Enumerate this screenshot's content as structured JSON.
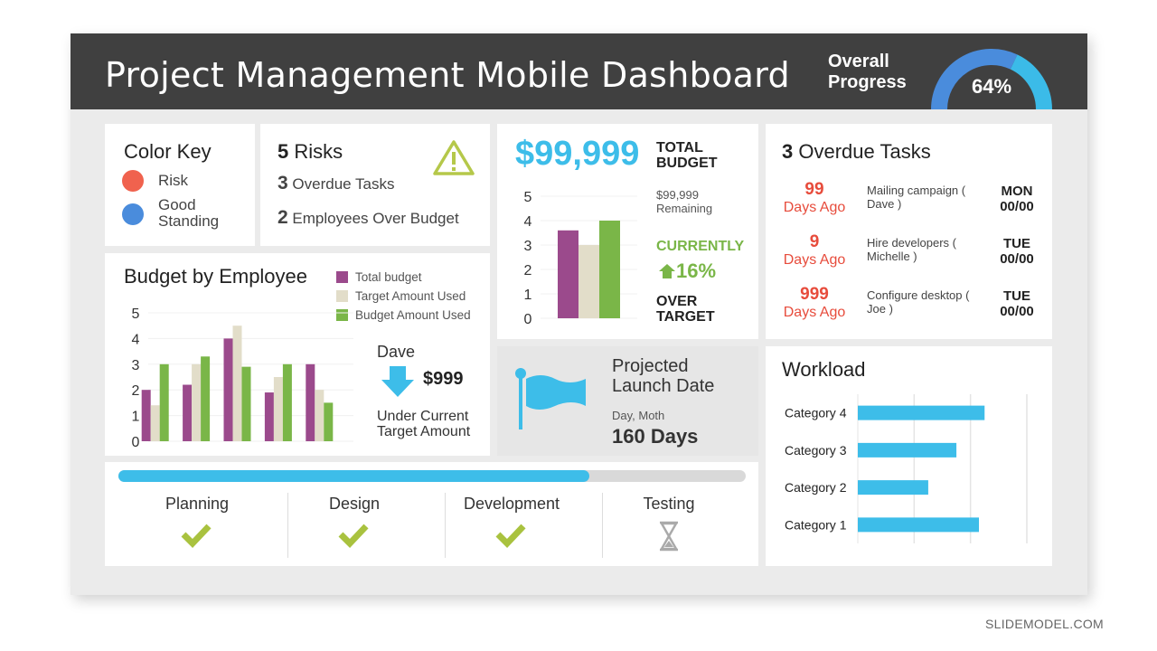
{
  "header": {
    "title": "Project Management Mobile Dashboard",
    "overall_progress_label": "Overall Progress",
    "overall_progress_pct": 64,
    "overall_progress_text": "64%",
    "gauge_colors": [
      "#4a8cdc",
      "#3bbbe8"
    ]
  },
  "color_key": {
    "title": "Color Key",
    "items": [
      {
        "label": "Risk",
        "color": "#f0624e"
      },
      {
        "label": "Good Standing",
        "color": "#4a8cdc"
      }
    ]
  },
  "risks": {
    "count": "5",
    "title": "Risks",
    "icon": "warning-icon",
    "items": [
      {
        "count": "3",
        "label": "Overdue Tasks"
      },
      {
        "count": "2",
        "label": "Employees Over Budget"
      }
    ]
  },
  "budget": {
    "amount": "$99,999",
    "label": "TOTAL BUDGET",
    "remaining_amount": "$99,999",
    "remaining_label": "Remaining",
    "currently": "CURRENTLY",
    "change": "16%",
    "change_icon": "arrow-up-icon",
    "over_target": "OVER TARGET"
  },
  "overdue": {
    "count": "3",
    "title": "Overdue Tasks",
    "tasks": [
      {
        "days": "99",
        "days_label": "Days Ago",
        "task": "Mailing campaign ( Dave )",
        "day": "MON",
        "date": "00/00"
      },
      {
        "days": "9",
        "days_label": "Days Ago",
        "task": "Hire developers ( Michelle )",
        "day": "TUE",
        "date": "00/00"
      },
      {
        "days": "999",
        "days_label": "Days Ago",
        "task": "Configure desktop ( Joe )",
        "day": "TUE",
        "date": "00/00"
      }
    ]
  },
  "employee_callout": {
    "name": "Dave",
    "amount": "$999",
    "note": "Under Current Target Amount",
    "icon": "arrow-down-icon"
  },
  "launch": {
    "title": "Projected Launch Date",
    "date": "Day, Moth",
    "days": "160 Days",
    "icon": "flag-icon"
  },
  "phases": {
    "progress_pct": 75,
    "items": [
      {
        "label": "Planning",
        "status": "done"
      },
      {
        "label": "Design",
        "status": "done"
      },
      {
        "label": "Development",
        "status": "done"
      },
      {
        "label": "Testing",
        "status": "pending"
      }
    ]
  },
  "footer": {
    "brand": "SLIDEMODEL.COM"
  },
  "chart_data": [
    {
      "type": "bar",
      "title": "Budget by Employee",
      "categories": [
        "",
        "",
        "",
        "",
        ""
      ],
      "ylim": [
        0,
        5
      ],
      "yticks": [
        0,
        1,
        2,
        3,
        4,
        5
      ],
      "grid": true,
      "legend": "top-right",
      "series": [
        {
          "name": "Total budget",
          "color": "#9b4a8c",
          "values": [
            2,
            2.2,
            4,
            1.9,
            3
          ]
        },
        {
          "name": "Target Amount Used",
          "color": "#e2ddc9",
          "values": [
            1.4,
            3,
            4.5,
            2.5,
            2
          ]
        },
        {
          "name": "Budget Amount Used",
          "color": "#7ab648",
          "values": [
            3,
            3.3,
            2.9,
            3,
            1.5
          ]
        }
      ]
    },
    {
      "type": "bar",
      "categories": [
        ""
      ],
      "ylim": [
        0,
        5
      ],
      "yticks": [
        0,
        1,
        2,
        3,
        4,
        5
      ],
      "grid": true,
      "series": [
        {
          "color": "#9b4a8c",
          "values": [
            3.6
          ]
        },
        {
          "color": "#e2ddc9",
          "values": [
            3
          ]
        },
        {
          "color": "#7ab648",
          "values": [
            4
          ]
        }
      ]
    },
    {
      "type": "bar",
      "orientation": "horizontal",
      "title": "Workload",
      "categories": [
        "Category 4",
        "Category 3",
        "Category 2",
        "Category 1"
      ],
      "xlim": [
        0,
        3
      ],
      "grid": true,
      "color": "#3dbde9",
      "values": [
        2.25,
        1.75,
        1.25,
        2.15
      ]
    }
  ]
}
